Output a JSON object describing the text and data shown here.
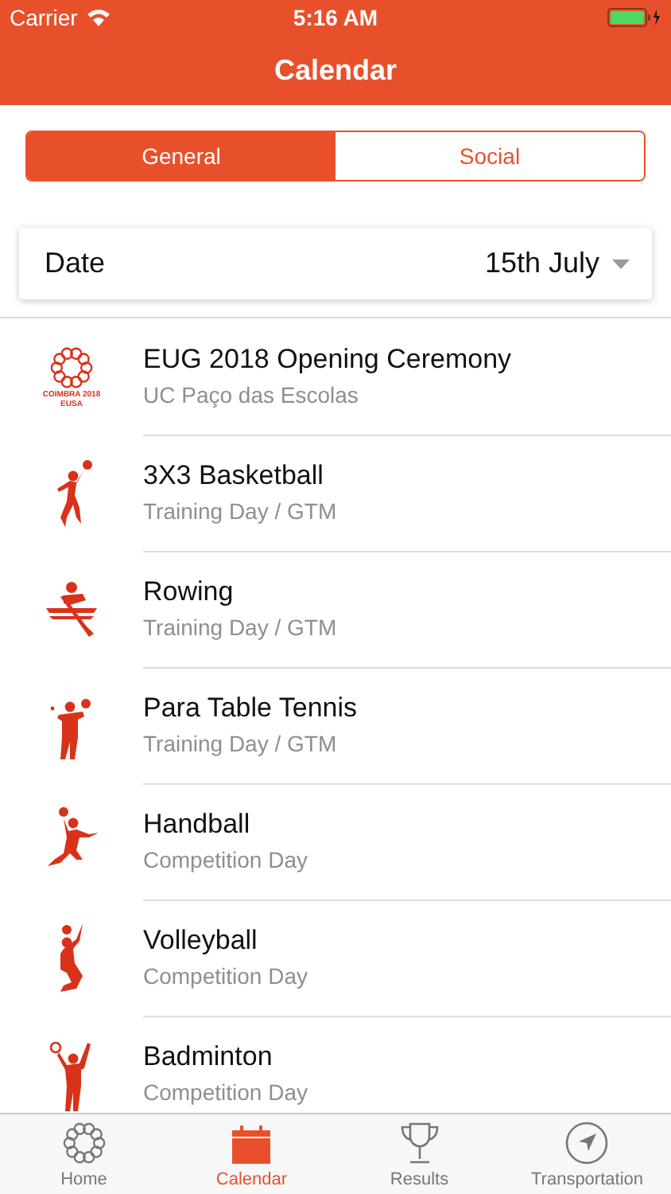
{
  "status_bar": {
    "carrier": "Carrier",
    "time": "5:16 AM"
  },
  "nav_bar": {
    "title": "Calendar"
  },
  "segments": [
    {
      "label": "General",
      "selected": true
    },
    {
      "label": "Social",
      "selected": false
    }
  ],
  "date_picker": {
    "label": "Date",
    "value": "15th July"
  },
  "events": [
    {
      "kind": "ceremony",
      "title": "EUG 2018 Opening Ceremony",
      "subtitle": "UC Paço das Escolas",
      "logo_text": [
        "COIMBRA 2018",
        "EUSA"
      ]
    },
    {
      "kind": "basketball",
      "title": "3X3 Basketball",
      "subtitle": "Training Day / GTM"
    },
    {
      "kind": "rowing",
      "title": "Rowing",
      "subtitle": "Training Day / GTM"
    },
    {
      "kind": "table-tennis",
      "title": "Para Table Tennis",
      "subtitle": "Training Day / GTM"
    },
    {
      "kind": "handball",
      "title": "Handball",
      "subtitle": "Competition Day"
    },
    {
      "kind": "volleyball",
      "title": "Volleyball",
      "subtitle": "Competition Day"
    },
    {
      "kind": "badminton",
      "title": "Badminton",
      "subtitle": "Competition Day"
    }
  ],
  "tab_bar": [
    {
      "kind": "home",
      "label": "Home",
      "selected": false
    },
    {
      "kind": "calendar",
      "label": "Calendar",
      "selected": true
    },
    {
      "kind": "results",
      "label": "Results",
      "selected": false
    },
    {
      "kind": "transportation",
      "label": "Transportation",
      "selected": false
    }
  ]
}
